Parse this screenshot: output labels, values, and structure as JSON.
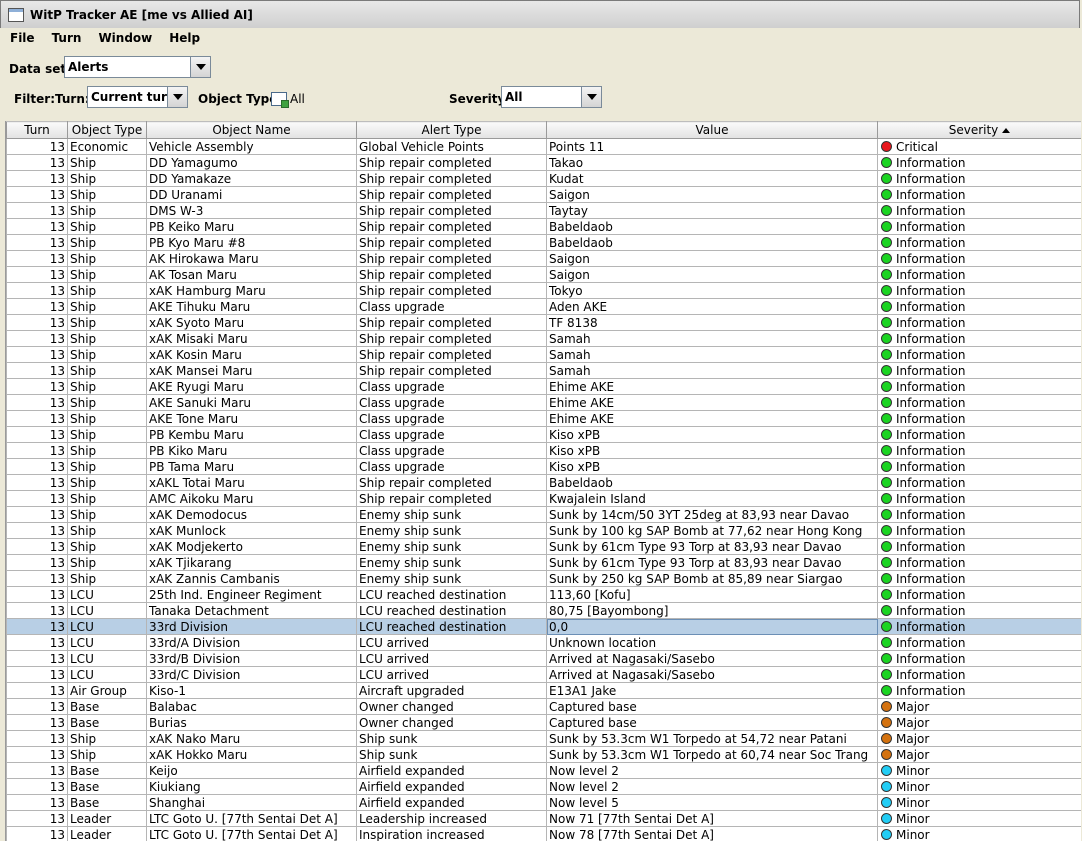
{
  "window": {
    "title": "WitP Tracker AE [me vs Allied AI]"
  },
  "menu": [
    "File",
    "Turn",
    "Window",
    "Help"
  ],
  "toolbar": {
    "dataset_label": "Data set:",
    "dataset_value": "Alerts",
    "filter_label": "Filter:",
    "turn_label": "Turn:",
    "turn_value": "Current turn",
    "objtype_label": "Object Type:",
    "objtype_value": "All",
    "severity_label": "Severity:",
    "severity_value": "All"
  },
  "table": {
    "columns": [
      "Turn",
      "Object Type",
      "Object Name",
      "Alert Type",
      "Value",
      "Severity"
    ],
    "sorted_column": "Severity",
    "selected_row": 30,
    "severity_colors": {
      "Critical": "#e8161c",
      "Information": "#1bd422",
      "Major": "#d4720f",
      "Minor": "#22cdf5"
    },
    "rows": [
      [
        "13",
        "Economic",
        "Vehicle Assembly",
        "Global Vehicle Points",
        "Points 11",
        "Critical"
      ],
      [
        "13",
        "Ship",
        "DD Yamagumo",
        "Ship repair completed",
        "Takao",
        "Information"
      ],
      [
        "13",
        "Ship",
        "DD Yamakaze",
        "Ship repair completed",
        "Kudat",
        "Information"
      ],
      [
        "13",
        "Ship",
        "DD Uranami",
        "Ship repair completed",
        "Saigon",
        "Information"
      ],
      [
        "13",
        "Ship",
        "DMS W-3",
        "Ship repair completed",
        "Taytay",
        "Information"
      ],
      [
        "13",
        "Ship",
        "PB Keiko Maru",
        "Ship repair completed",
        "Babeldaob",
        "Information"
      ],
      [
        "13",
        "Ship",
        "PB Kyo Maru #8",
        "Ship repair completed",
        "Babeldaob",
        "Information"
      ],
      [
        "13",
        "Ship",
        "AK Hirokawa Maru",
        "Ship repair completed",
        "Saigon",
        "Information"
      ],
      [
        "13",
        "Ship",
        "AK Tosan Maru",
        "Ship repair completed",
        "Saigon",
        "Information"
      ],
      [
        "13",
        "Ship",
        "xAK Hamburg Maru",
        "Ship repair completed",
        "Tokyo",
        "Information"
      ],
      [
        "13",
        "Ship",
        "AKE Tihuku Maru",
        "Class upgrade",
        "Aden AKE",
        "Information"
      ],
      [
        "13",
        "Ship",
        "xAK Syoto Maru",
        "Ship repair completed",
        "TF 8138",
        "Information"
      ],
      [
        "13",
        "Ship",
        "xAK Misaki Maru",
        "Ship repair completed",
        "Samah",
        "Information"
      ],
      [
        "13",
        "Ship",
        "xAK Kosin Maru",
        "Ship repair completed",
        "Samah",
        "Information"
      ],
      [
        "13",
        "Ship",
        "xAK Mansei Maru",
        "Ship repair completed",
        "Samah",
        "Information"
      ],
      [
        "13",
        "Ship",
        "AKE Ryugi Maru",
        "Class upgrade",
        "Ehime AKE",
        "Information"
      ],
      [
        "13",
        "Ship",
        "AKE Sanuki Maru",
        "Class upgrade",
        "Ehime AKE",
        "Information"
      ],
      [
        "13",
        "Ship",
        "AKE Tone Maru",
        "Class upgrade",
        "Ehime AKE",
        "Information"
      ],
      [
        "13",
        "Ship",
        "PB Kembu Maru",
        "Class upgrade",
        "Kiso xPB",
        "Information"
      ],
      [
        "13",
        "Ship",
        "PB Kiko Maru",
        "Class upgrade",
        "Kiso xPB",
        "Information"
      ],
      [
        "13",
        "Ship",
        "PB Tama Maru",
        "Class upgrade",
        "Kiso xPB",
        "Information"
      ],
      [
        "13",
        "Ship",
        "xAKL Totai Maru",
        "Ship repair completed",
        "Babeldaob",
        "Information"
      ],
      [
        "13",
        "Ship",
        "AMC Aikoku Maru",
        "Ship repair completed",
        "Kwajalein Island",
        "Information"
      ],
      [
        "13",
        "Ship",
        "xAK Demodocus",
        "Enemy ship sunk",
        "Sunk by 14cm/50 3YT 25deg at 83,93 near Davao",
        "Information"
      ],
      [
        "13",
        "Ship",
        "xAK Munlock",
        "Enemy ship sunk",
        "Sunk by 100 kg SAP Bomb at 77,62 near Hong Kong",
        "Information"
      ],
      [
        "13",
        "Ship",
        "xAK Modjekerto",
        "Enemy ship sunk",
        "Sunk by 61cm Type 93 Torp at 83,93 near Davao",
        "Information"
      ],
      [
        "13",
        "Ship",
        "xAK Tjikarang",
        "Enemy ship sunk",
        "Sunk by 61cm Type 93 Torp at 83,93 near Davao",
        "Information"
      ],
      [
        "13",
        "Ship",
        "xAK Zannis Cambanis",
        "Enemy ship sunk",
        "Sunk by 250 kg SAP Bomb at 85,89 near Siargao",
        "Information"
      ],
      [
        "13",
        "LCU",
        "25th Ind. Engineer Regiment",
        "LCU reached destination",
        "113,60 [Kofu]",
        "Information"
      ],
      [
        "13",
        "LCU",
        "Tanaka Detachment",
        "LCU reached destination",
        "80,75 [Bayombong]",
        "Information"
      ],
      [
        "13",
        "LCU",
        "33rd Division",
        "LCU reached destination",
        "0,0",
        "Information"
      ],
      [
        "13",
        "LCU",
        "33rd/A Division",
        "LCU arrived",
        "Unknown location",
        "Information"
      ],
      [
        "13",
        "LCU",
        "33rd/B Division",
        "LCU arrived",
        "Arrived at Nagasaki/Sasebo",
        "Information"
      ],
      [
        "13",
        "LCU",
        "33rd/C Division",
        "LCU arrived",
        "Arrived at Nagasaki/Sasebo",
        "Information"
      ],
      [
        "13",
        "Air Group",
        "Kiso-1",
        "Aircraft upgraded",
        "E13A1 Jake",
        "Information"
      ],
      [
        "13",
        "Base",
        "Balabac",
        "Owner changed",
        "Captured base",
        "Major"
      ],
      [
        "13",
        "Base",
        "Burias",
        "Owner changed",
        "Captured base",
        "Major"
      ],
      [
        "13",
        "Ship",
        "xAK Nako Maru",
        "Ship sunk",
        "Sunk by 53.3cm W1 Torpedo at 54,72 near Patani",
        "Major"
      ],
      [
        "13",
        "Ship",
        "xAK Hokko Maru",
        "Ship sunk",
        "Sunk by 53.3cm W1 Torpedo at 60,74 near Soc Trang",
        "Major"
      ],
      [
        "13",
        "Base",
        "Keijo",
        "Airfield expanded",
        "Now level 2",
        "Minor"
      ],
      [
        "13",
        "Base",
        "Kiukiang",
        "Airfield expanded",
        "Now level 2",
        "Minor"
      ],
      [
        "13",
        "Base",
        "Shanghai",
        "Airfield expanded",
        "Now level 5",
        "Minor"
      ],
      [
        "13",
        "Leader",
        "LTC Goto U. [77th Sentai Det A]",
        "Leadership increased",
        "Now 71 [77th Sentai Det A]",
        "Minor"
      ],
      [
        "13",
        "Leader",
        "LTC Goto U. [77th Sentai Det A]",
        "Inspiration increased",
        "Now 78 [77th Sentai Det A]",
        "Minor"
      ]
    ]
  }
}
